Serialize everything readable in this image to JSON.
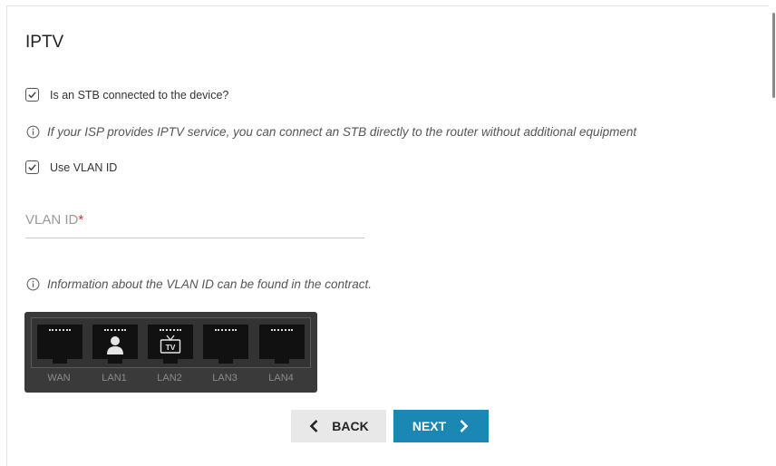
{
  "page": {
    "title": "IPTV"
  },
  "stb_option": {
    "label": "Is an STB connected to the device?",
    "checked": true
  },
  "info_stb": "If your ISP provides IPTV service, you can connect an STB directly to the router without additional equipment",
  "vlan_option": {
    "label": "Use VLAN ID",
    "checked": true
  },
  "vlan_field": {
    "label": "VLAN ID",
    "required_mark": "*",
    "value": ""
  },
  "info_vlan": "Information about the VLAN ID can be found in the contract.",
  "ports": [
    {
      "label": "WAN",
      "icon": ""
    },
    {
      "label": "LAN1",
      "icon": "user-icon"
    },
    {
      "label": "LAN2",
      "icon": "tv-icon",
      "icon_text": "TV"
    },
    {
      "label": "LAN3",
      "icon": ""
    },
    {
      "label": "LAN4",
      "icon": ""
    }
  ],
  "buttons": {
    "back": "BACK",
    "next": "NEXT"
  },
  "colors": {
    "next_bg": "#1a87b5",
    "back_bg": "#e8e8e8",
    "required": "#d9302a"
  }
}
